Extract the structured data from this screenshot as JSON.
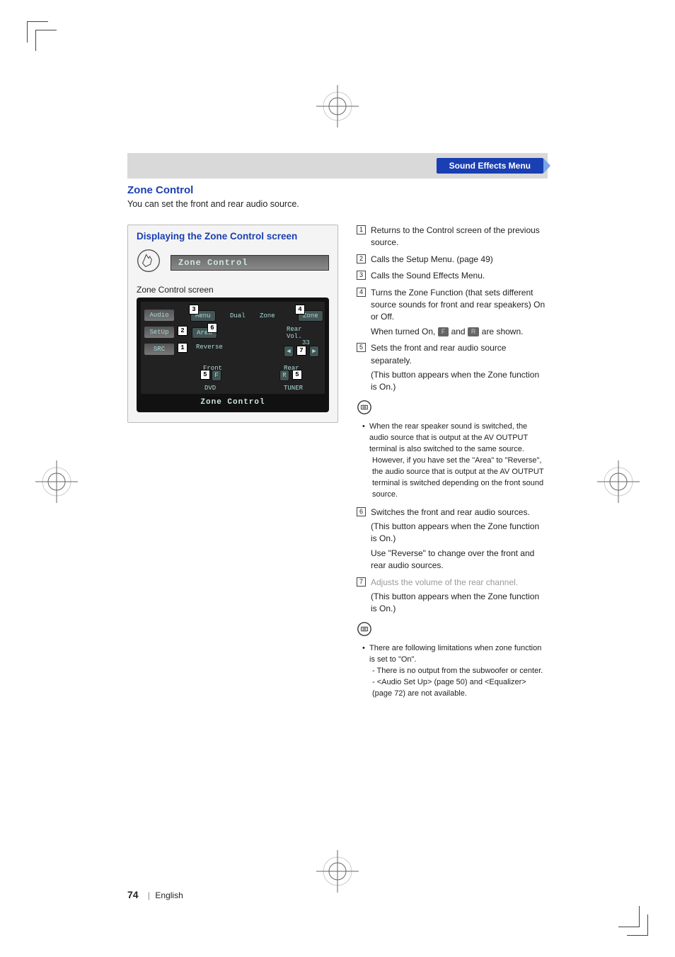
{
  "banner": {
    "title": "Sound Effects Menu"
  },
  "section": {
    "heading": "Zone Control",
    "sub": "You can set the front and rear audio source."
  },
  "box": {
    "title": "Displaying the Zone Control screen",
    "touch_label": "Zone Control",
    "screen_caption": "Zone Control screen",
    "footer_label": "Zone Control",
    "side_buttons": [
      "Audio",
      "SetUp",
      "SRC"
    ],
    "top_labels": {
      "menu": "Menu",
      "dual": "Dual",
      "zone_hdr": "Zone",
      "zone_btn": "Zone"
    },
    "mid": {
      "area": "Area",
      "reverse": "Reverse",
      "rear_vol": "Rear Vol.",
      "rear_vol_val": "33"
    },
    "bottom": {
      "front": "Front",
      "rear": "Rear",
      "dvd": "DVD",
      "tuner": "TUNER",
      "f": "F",
      "r": "R"
    },
    "callouts": {
      "c1": "1",
      "c2": "2",
      "c3": "3",
      "c4": "4",
      "c5a": "5",
      "c5b": "5",
      "c6": "6",
      "c7": "7"
    }
  },
  "items": {
    "i1": "Returns to the Control screen of the previous source.",
    "i2": "Calls the Setup Menu. (page 49)",
    "i3": "Calls the Sound Effects Menu.",
    "i4a": "Turns the Zone Function (that sets different source sounds for front and rear speakers) On or Off.",
    "i4b_pre": "When turned On, ",
    "i4b_f": "F",
    "i4b_mid": " and ",
    "i4b_r": "R",
    "i4b_post": " are shown.",
    "i5a": "Sets the front and rear audio source separately.",
    "i5b": "(This button appears when the Zone function is On.)",
    "i6a": "Switches the front and rear audio sources.",
    "i6b": "(This button appears when the Zone function is On.)",
    "i6c": "Use \"Reverse\" to change over the front and rear audio sources.",
    "i7a": "Adjusts the volume of the rear channel.",
    "i7b": "(This button appears when the Zone function is On.)"
  },
  "note1": {
    "a": "When the rear speaker sound is switched, the audio source that is output at the AV OUTPUT terminal is also switched to the same source.",
    "b": "However, if you have set the \"Area\" to \"Reverse\", the audio source that is output at the AV OUTPUT terminal is switched depending on the front sound source."
  },
  "note2": {
    "a": "There are following limitations when zone function is set to \"On\".",
    "b": "- There is no output from the subwoofer or center.",
    "c": "- <Audio Set Up> (page 50) and <Equalizer> (page 72) are not available."
  },
  "nums": {
    "n1": "1",
    "n2": "2",
    "n3": "3",
    "n4": "4",
    "n5": "5",
    "n6": "6",
    "n7": "7"
  },
  "footer": {
    "page": "74",
    "lang": "English"
  }
}
